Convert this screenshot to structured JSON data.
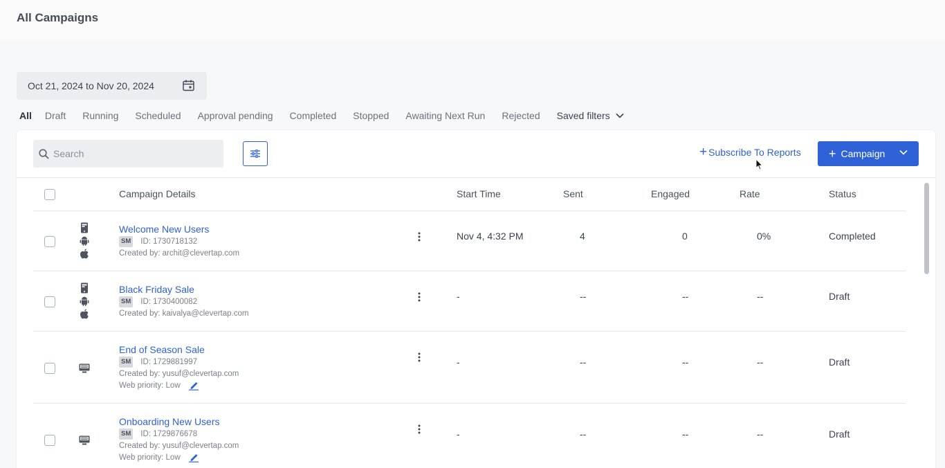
{
  "page": {
    "title": "All Campaigns"
  },
  "date_range": {
    "label": "Oct 21, 2024 to Nov 20, 2024",
    "icon": "calendar-icon"
  },
  "filters": {
    "tabs": [
      "All",
      "Draft",
      "Running",
      "Scheduled",
      "Approval pending",
      "Completed",
      "Stopped",
      "Awaiting Next Run",
      "Rejected"
    ],
    "active": "All",
    "saved_filters_label": "Saved filters"
  },
  "toolbar": {
    "search_placeholder": "Search",
    "subscribe_label": "Subscribe To Reports",
    "add_campaign_label": "Campaign"
  },
  "table": {
    "columns": {
      "details": "Campaign Details",
      "start_time": "Start Time",
      "sent": "Sent",
      "engaged": "Engaged",
      "rate": "Rate",
      "status": "Status"
    },
    "rows": [
      {
        "name": "Welcome New Users",
        "badge": "SM",
        "id": "ID: 1730718132",
        "created_by": "Created by: archit@clevertap.com",
        "platforms": [
          "mobile-icon",
          "android-icon",
          "apple-icon"
        ],
        "start_time": "Nov 4, 4:32 PM",
        "sent": "4",
        "engaged": "0",
        "rate": "0%",
        "status": "Completed"
      },
      {
        "name": "Black Friday Sale",
        "badge": "SM",
        "id": "ID: 1730400082",
        "created_by": "Created by: kaivalya@clevertap.com",
        "platforms": [
          "mobile-icon",
          "android-icon",
          "apple-icon"
        ],
        "start_time": "-",
        "sent": "--",
        "engaged": "--",
        "rate": "--",
        "status": "Draft"
      },
      {
        "name": "End of Season Sale",
        "badge": "SM",
        "id": "ID: 1729881997",
        "created_by": "Created by: yusuf@clevertap.com",
        "web_priority": "Web priority: Low",
        "platforms": [
          "desktop-icon"
        ],
        "start_time": "-",
        "sent": "--",
        "engaged": "--",
        "rate": "--",
        "status": "Draft"
      },
      {
        "name": "Onboarding New Users",
        "badge": "SM",
        "id": "ID: 1729876678",
        "created_by": "Created by: yusuf@clevertap.com",
        "web_priority": "Web priority: Low",
        "platforms": [
          "desktop-icon"
        ],
        "start_time": "-",
        "sent": "--",
        "engaged": "--",
        "rate": "--",
        "status": "Draft"
      }
    ]
  },
  "colors": {
    "accent": "#2e62d6",
    "text": "#3c4250",
    "muted": "#7a808a",
    "background": "#f7f8fa"
  }
}
